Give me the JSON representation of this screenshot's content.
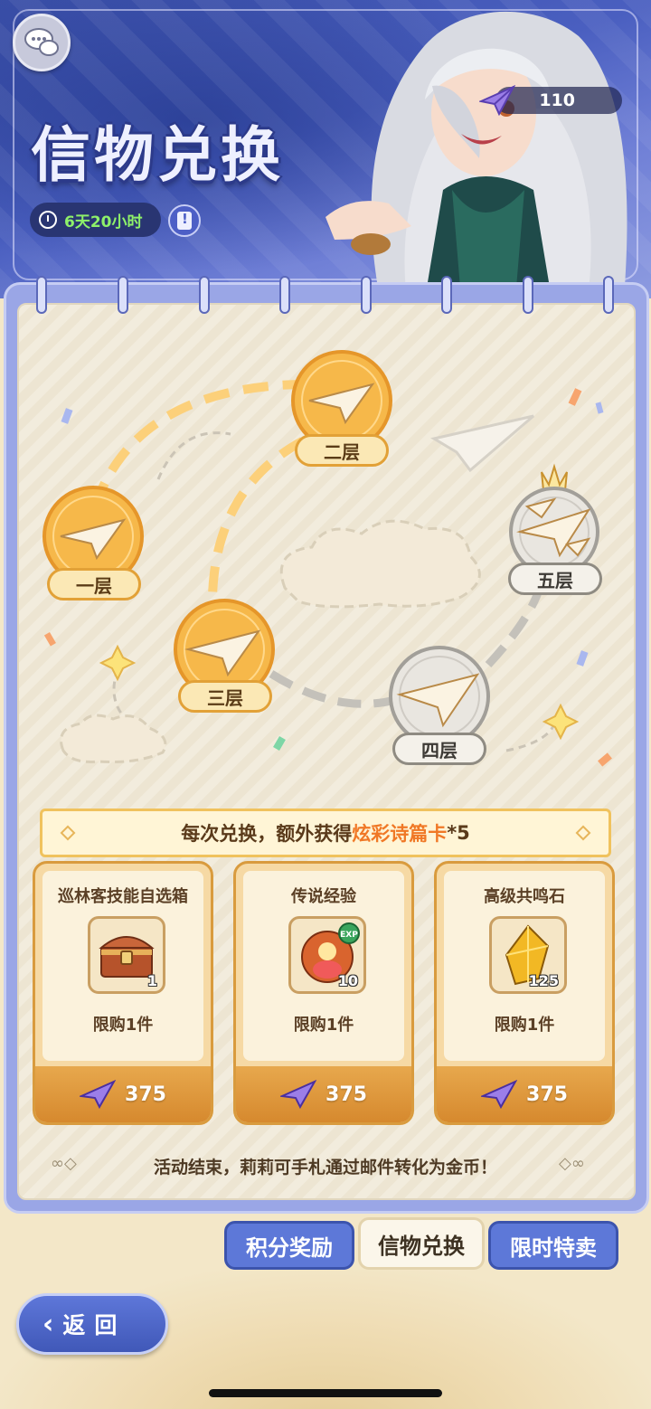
{
  "header": {
    "title": "信物兑换",
    "timer": "6天20小时",
    "currency_value": "110"
  },
  "floors": [
    {
      "label": "一层",
      "state": "unlocked"
    },
    {
      "label": "二层",
      "state": "unlocked"
    },
    {
      "label": "三层",
      "state": "unlocked"
    },
    {
      "label": "四层",
      "state": "locked"
    },
    {
      "label": "五层",
      "state": "locked"
    }
  ],
  "ribbon": {
    "prefix": "每次兑换，额外获得",
    "highlight": "炫彩诗篇卡",
    "suffix": "*5"
  },
  "shop": {
    "items": [
      {
        "name": "巡林客技能自选箱",
        "count": "1",
        "limit": "限购1件",
        "price": "375",
        "icon": "treasure-chest-icon"
      },
      {
        "name": "传说经验",
        "count": "10",
        "limit": "限购1件",
        "price": "375",
        "icon": "exp-slime-icon"
      },
      {
        "name": "高级共鸣石",
        "count": "125",
        "limit": "限购1件",
        "price": "375",
        "icon": "gold-gem-icon"
      }
    ]
  },
  "footer_note": "活动结束，莉莉可手札通过邮件转化为金币！",
  "tabs": [
    {
      "label": "积分奖励",
      "active": false
    },
    {
      "label": "信物兑换",
      "active": true
    },
    {
      "label": "限时特卖",
      "active": false
    }
  ],
  "back_button": "返回",
  "colors": {
    "accent_blue": "#5d78d8",
    "gold": "#e2a137",
    "highlight_orange": "#f07826",
    "timer_green": "#8ef06a"
  }
}
